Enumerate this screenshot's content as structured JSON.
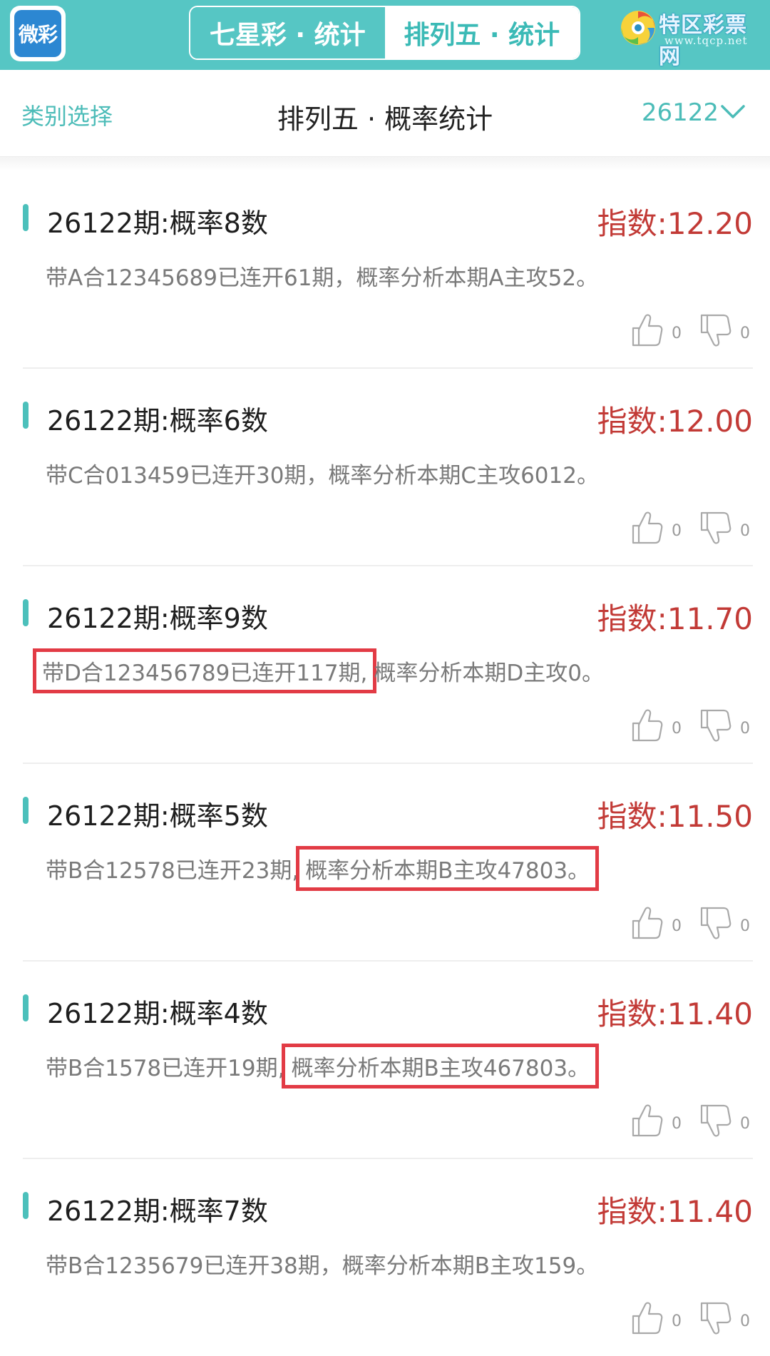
{
  "header": {
    "logo_text": "微彩",
    "tabs": [
      {
        "label": "七星彩 · 统计",
        "active": false
      },
      {
        "label": "排列五 · 统计",
        "active": true
      }
    ],
    "brand": {
      "name": "特区彩票网",
      "url": "www.tqcp.net"
    },
    "colors": {
      "bar": "#56c6c4",
      "accent": "#4cbcb8",
      "index_red": "#c23a36",
      "highlight_box": "#e23b45"
    }
  },
  "subheader": {
    "category_label": "类别选择",
    "title": "排列五 · 概率统计",
    "issue": "26122"
  },
  "cards": [
    {
      "title": "26122期:概率8数",
      "index": "指数:12.20",
      "desc_pre": "带A合12345689已连开61期，概率分析本期A主攻52。",
      "desc_hl": "",
      "desc_post": "",
      "likes": "0",
      "dislikes": "0"
    },
    {
      "title": "26122期:概率6数",
      "index": "指数:12.00",
      "desc_pre": "带C合013459已连开30期，概率分析本期C主攻6012。",
      "desc_hl": "",
      "desc_post": "",
      "likes": "0",
      "dislikes": "0"
    },
    {
      "title": "26122期:概率9数",
      "index": "指数:11.70",
      "desc_pre": "",
      "desc_hl": "带D合123456789已连开117期,",
      "desc_post": "概率分析本期D主攻0。",
      "likes": "0",
      "dislikes": "0"
    },
    {
      "title": "26122期:概率5数",
      "index": "指数:11.50",
      "desc_pre": "带B合12578已连开23期,",
      "desc_hl": "概率分析本期B主攻47803。",
      "desc_post": "",
      "likes": "0",
      "dislikes": "0"
    },
    {
      "title": "26122期:概率4数",
      "index": "指数:11.40",
      "desc_pre": "带B合1578已连开19期,",
      "desc_hl": "概率分析本期B主攻467803。",
      "desc_post": "",
      "likes": "0",
      "dislikes": "0"
    },
    {
      "title": "26122期:概率7数",
      "index": "指数:11.40",
      "desc_pre": "带B合1235679已连开38期，概率分析本期B主攻159。",
      "desc_hl": "",
      "desc_post": "",
      "likes": "0",
      "dislikes": "0"
    }
  ]
}
